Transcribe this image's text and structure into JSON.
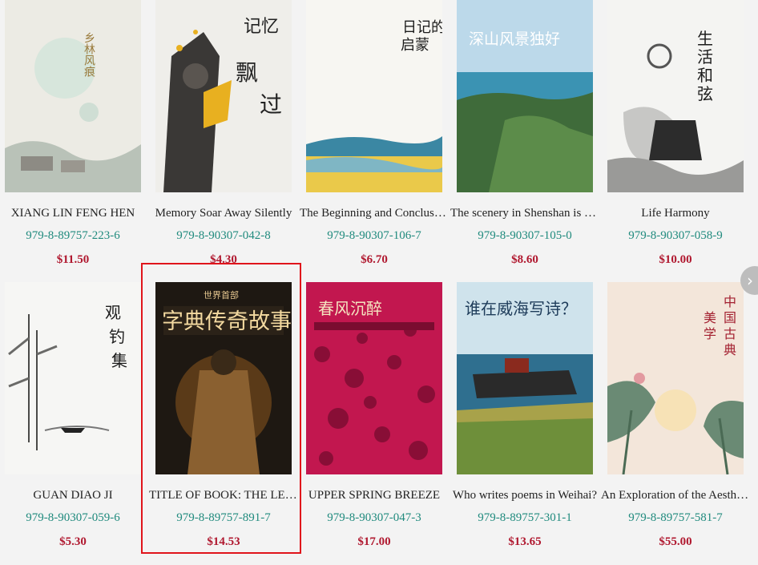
{
  "books": [
    {
      "title": "XIANG LIN FENG HEN",
      "isbn": "979-8-89757-223-6",
      "price": "$11.50",
      "cover_text": "乡林风痕"
    },
    {
      "title": "Memory Soar Away Silently",
      "isbn": "979-8-90307-042-8",
      "price": "$4.30",
      "cover_text": "记忆悄然飘过"
    },
    {
      "title": "The Beginning and Conclusion of the Diary",
      "isbn": "979-8-90307-106-7",
      "price": "$6.70",
      "cover_text": "日记的启蒙与归宿"
    },
    {
      "title": "The scenery in Shenshan is unique",
      "isbn": "979-8-90307-105-0",
      "price": "$8.60",
      "cover_text": "深山风景独好"
    },
    {
      "title": "Life Harmony",
      "isbn": "979-8-90307-058-9",
      "price": "$10.00",
      "cover_text": "生活和弦"
    },
    {
      "title": "GUAN DIAO JI",
      "isbn": "979-8-90307-059-6",
      "price": "$5.30",
      "cover_text": "观钓集"
    },
    {
      "title": "TITLE OF BOOK: THE LEGENDARY STORY",
      "isbn": "979-8-89757-891-7",
      "price": "$14.53",
      "cover_text": "字典传奇故事"
    },
    {
      "title": "UPPER SPRING BREEZE",
      "isbn": "979-8-90307-047-3",
      "price": "$17.00",
      "cover_text": "春风沉醉"
    },
    {
      "title": "Who writes poems in Weihai?",
      "isbn": "979-8-89757-301-1",
      "price": "$13.65",
      "cover_text": "谁在威海写诗？"
    },
    {
      "title": "An Exploration of the Aesthetics",
      "isbn": "979-8-89757-581-7",
      "price": "$55.00",
      "cover_text": "中国古典诗词美学探幽"
    }
  ],
  "next_icon": "chevron-right-icon",
  "next_symbol": "›"
}
